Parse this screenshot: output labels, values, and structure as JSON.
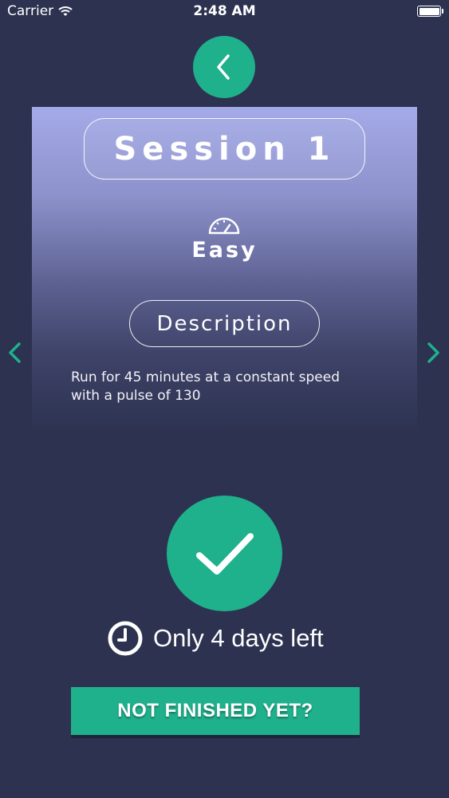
{
  "status_bar": {
    "carrier": "Carrier",
    "time": "2:48 AM",
    "icons": [
      "wifi-icon",
      "battery-icon"
    ]
  },
  "navigation": {
    "back_icon": "chevron-left-icon",
    "previous_icon": "chevron-left-icon",
    "next_icon": "chevron-right-icon"
  },
  "session": {
    "title": "Session 1",
    "difficulty_icon": "speedometer-icon",
    "difficulty": "Easy",
    "description_heading": "Description",
    "description_lines": [
      "Run for 45 minutes at a constant speed",
      "with a pulse of 130"
    ]
  },
  "completion": {
    "check_icon": "checkmark-icon",
    "deadline_icon": "clock-icon",
    "deadline_text": "Only 4 days left",
    "not_finished_label": "NOT FINISHED YET?"
  },
  "colors": {
    "background": "#2c3250",
    "accent": "#1fb08c",
    "card_top": "#a5abe8"
  }
}
